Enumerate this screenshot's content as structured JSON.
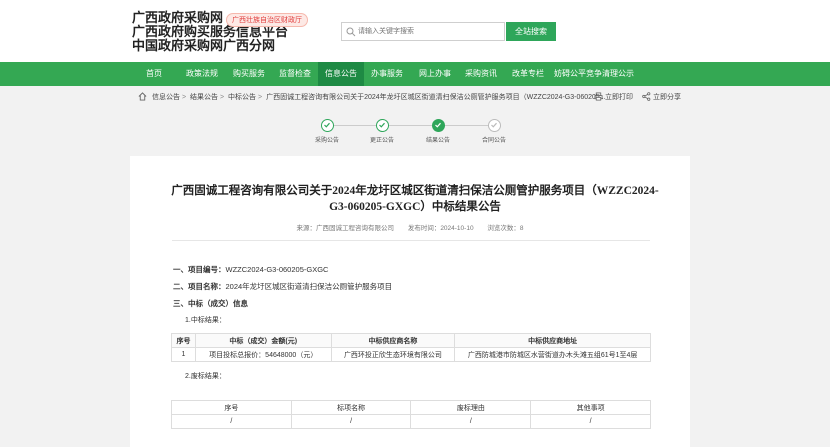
{
  "header": {
    "title_lines": [
      "广西政府采购网",
      "广西政府购买服务信息平台",
      "中国政府采购网广西分网"
    ],
    "dept_badge": "广西壮族自治区财政厅",
    "search_placeholder": "请输入关键字搜索",
    "search_button": "全站搜索"
  },
  "nav": {
    "items": [
      {
        "label": "首页"
      },
      {
        "label": "政策法规"
      },
      {
        "label": "购买服务"
      },
      {
        "label": "监督检查"
      },
      {
        "label": "信息公告",
        "active": true
      },
      {
        "label": "办事服务"
      },
      {
        "label": "网上办事"
      },
      {
        "label": "采购资讯"
      },
      {
        "label": "改革专栏"
      },
      {
        "label": "妨碍公平竞争清理公示"
      }
    ]
  },
  "breadcrumb": {
    "items": [
      "信息公告",
      "结果公告",
      "中标公告",
      "广西固诚工程咨询有限公司关于2024年龙圩区城区街道清扫保洁公厕管护服务项目（WZZC2024-G3-060205..."
    ],
    "print_label": "立即打印",
    "share_label": "立即分享"
  },
  "steps": [
    {
      "label": "采购公告",
      "state": "done"
    },
    {
      "label": "更正公告",
      "state": "done"
    },
    {
      "label": "结果公告",
      "state": "current"
    },
    {
      "label": "合同公告",
      "state": "pending"
    }
  ],
  "article": {
    "title_line1": "广西固诚工程咨询有限公司关于2024年龙圩区城区街道清扫保洁公厕管护服务项目（WZZC2024-",
    "title_line2": "G3-060205-GXGC）中标结果公告",
    "source": "来源：广西固诚工程咨询有限公司",
    "date": "发布时间：2024-10-10",
    "views": "浏览次数：8",
    "s1_label": "一、项目编号：",
    "s1_value": "WZZC2024-G3-060205-GXGC",
    "s2_label": "二、项目名称：",
    "s2_value": "2024年龙圩区城区街道清扫保洁公厕管护服务项目",
    "s3_label": "三、中标（成交）信息",
    "sub1": "1.中标结果：",
    "sub2": "2.废标结果："
  },
  "table1": {
    "headers": [
      "序号",
      "中标（成交）金额(元)",
      "中标供应商名称",
      "中标供应商地址"
    ],
    "rows": [
      [
        "1",
        "项目投标总报价：54648000（元）",
        "广西环投正欣生态环境有限公司",
        "广西防城港市防城区水营街道办木头滩五组61号1至4层"
      ]
    ]
  },
  "table2": {
    "headers": [
      "序号",
      "标项名称",
      "废标理由",
      "其他事项"
    ],
    "rows": [
      [
        "/",
        "/",
        "/",
        "/"
      ]
    ]
  }
}
